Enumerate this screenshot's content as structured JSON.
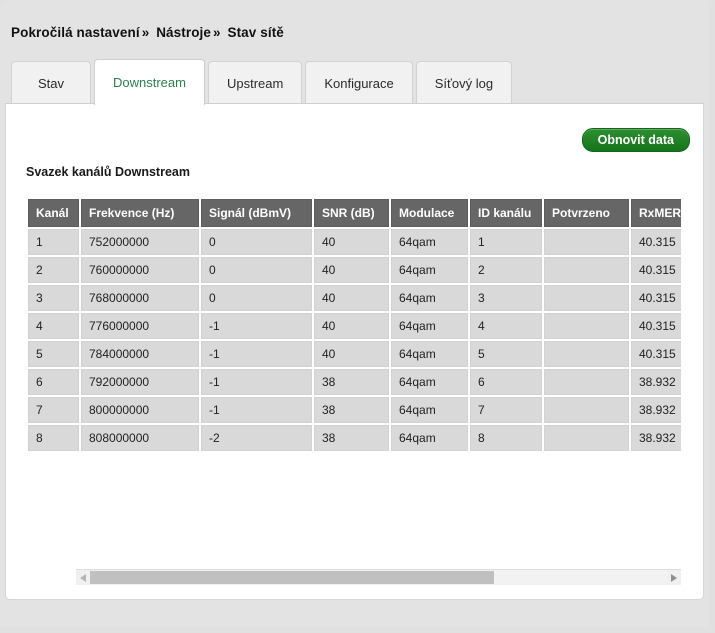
{
  "breadcrumb": {
    "items": [
      "Pokročilá nastavení",
      "Nástroje",
      "Stav sítě"
    ],
    "separator": "»"
  },
  "tabs": [
    {
      "label": "Stav",
      "active": false
    },
    {
      "label": "Downstream",
      "active": true
    },
    {
      "label": "Upstream",
      "active": false
    },
    {
      "label": "Konfigurace",
      "active": false
    },
    {
      "label": "Síťový log",
      "active": false
    }
  ],
  "toolbar": {
    "refresh_label": "Obnovit data"
  },
  "section": {
    "title": "Svazek kanálů Downstream"
  },
  "table": {
    "columns": [
      "Kanál",
      "Frekvence (Hz)",
      "Signál (dBmV)",
      "SNR (dB)",
      "Modulace",
      "ID kanálu",
      "Potvrzeno",
      "RxMER (dB)"
    ],
    "rows": [
      [
        "1",
        "752000000",
        "0",
        "40",
        "64qam",
        "1",
        "",
        "40.315"
      ],
      [
        "2",
        "760000000",
        "0",
        "40",
        "64qam",
        "2",
        "",
        "40.315"
      ],
      [
        "3",
        "768000000",
        "0",
        "40",
        "64qam",
        "3",
        "",
        "40.315"
      ],
      [
        "4",
        "776000000",
        "-1",
        "40",
        "64qam",
        "4",
        "",
        "40.315"
      ],
      [
        "5",
        "784000000",
        "-1",
        "40",
        "64qam",
        "5",
        "",
        "40.315"
      ],
      [
        "6",
        "792000000",
        "-1",
        "38",
        "64qam",
        "6",
        "",
        "38.932"
      ],
      [
        "7",
        "800000000",
        "-1",
        "38",
        "64qam",
        "7",
        "",
        "38.932"
      ],
      [
        "8",
        "808000000",
        "-2",
        "38",
        "64qam",
        "8",
        "",
        "38.932"
      ]
    ]
  },
  "scrollbar": {
    "left_arrow_icon": "triangle-left-icon",
    "right_arrow_icon": "triangle-right-icon",
    "thumb_percent": 70
  },
  "colors": {
    "accent_green": "#2e7d52",
    "button_green": "#1a7a1f",
    "header_gray": "#666666",
    "cell_gray": "#d9d9d9",
    "page_gray": "#e3e3e3"
  }
}
